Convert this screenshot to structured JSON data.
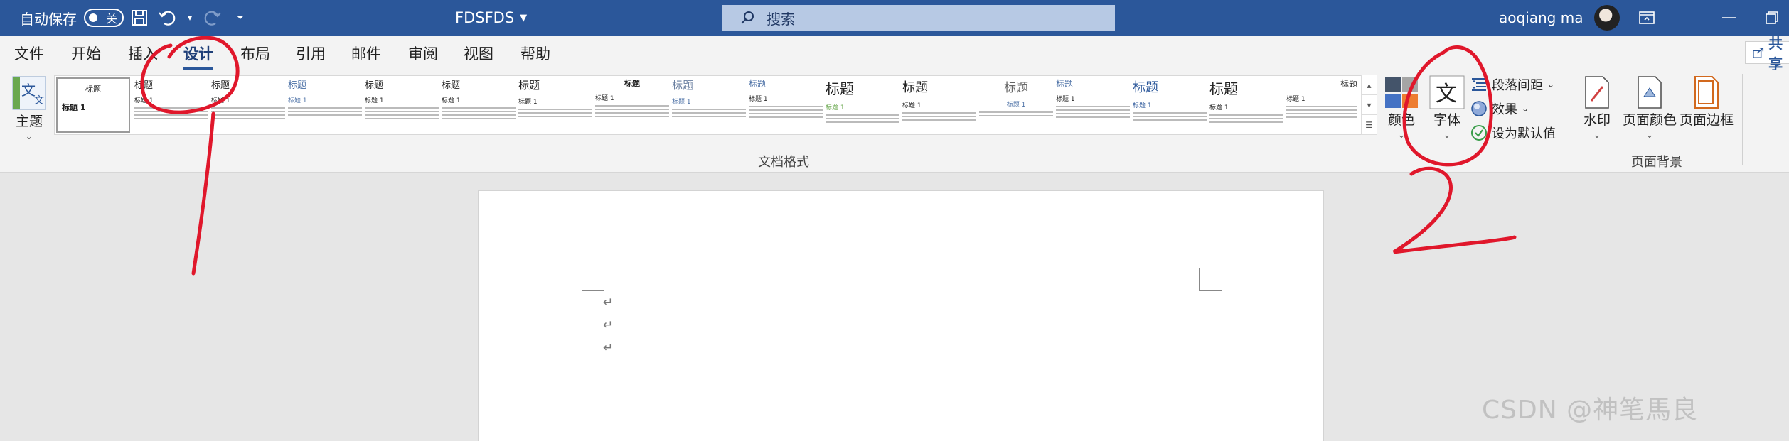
{
  "titlebar": {
    "autosave_label": "自动保存",
    "autosave_state": "关",
    "doc_title": "FDSFDS",
    "search_placeholder": "搜索",
    "user_name": "aoqiang ma"
  },
  "tabs": [
    "文件",
    "开始",
    "插入",
    "设计",
    "布局",
    "引用",
    "邮件",
    "审阅",
    "视图",
    "帮助"
  ],
  "active_tab": "设计",
  "share_label": "共享",
  "ribbon": {
    "theme_label": "主题",
    "doc_format_group": "文档格式",
    "colors_label": "颜色",
    "fonts_label": "字体",
    "paragraph_spacing": "段落间距",
    "effects": "效果",
    "set_default": "设为默认值",
    "watermark": "水印",
    "page_color": "页面颜色",
    "page_borders": "页面边框",
    "page_background_group": "页面背景"
  },
  "gallery": {
    "thumb_title": "标题",
    "thumb_heading": "标题 1"
  },
  "document": {
    "paragraph_mark": "↵"
  },
  "annotations": {
    "mark_1": "1",
    "mark_2": "2",
    "color": "#e0172b"
  },
  "watermark_text": "CSDN @神笔馬良"
}
